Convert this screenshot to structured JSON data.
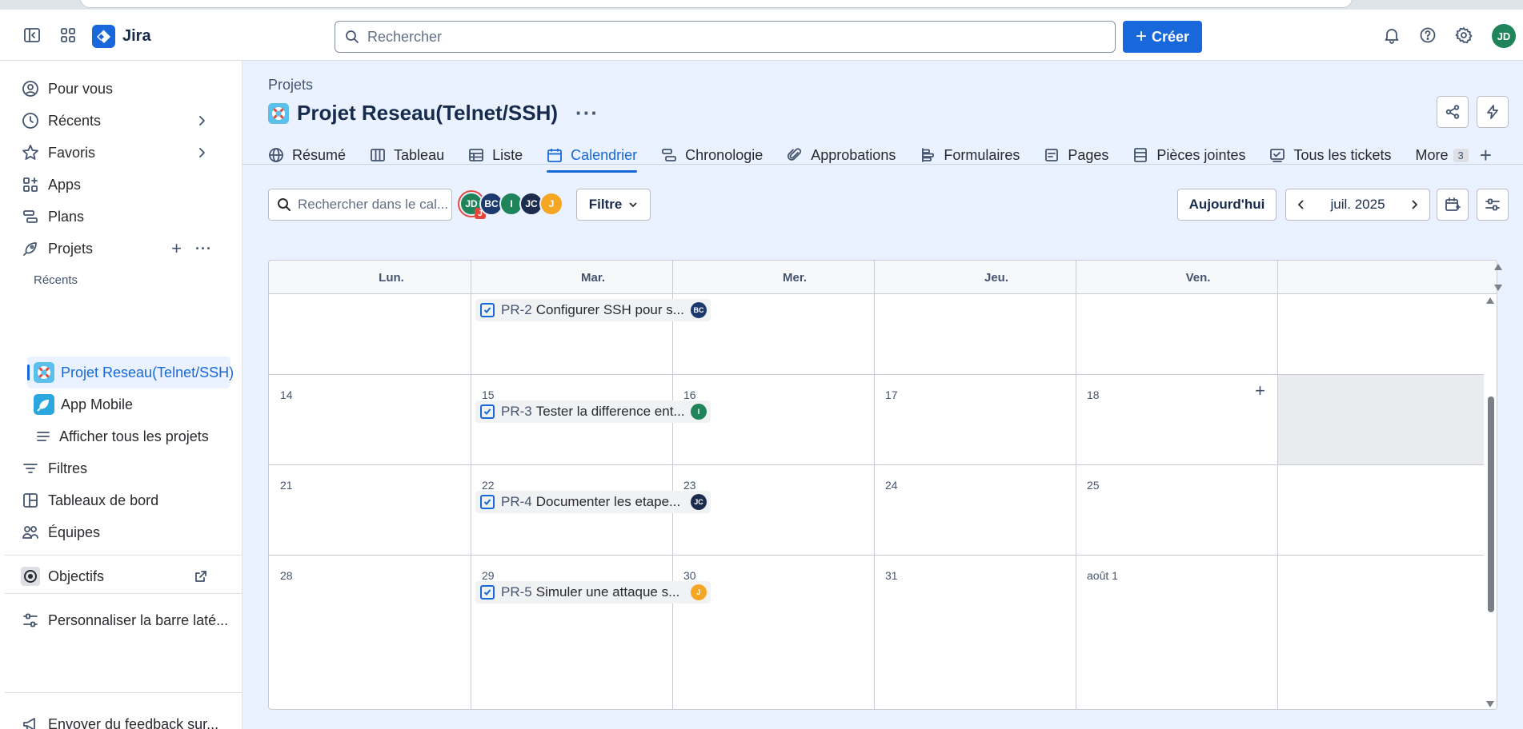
{
  "topnav": {
    "app_name": "Jira",
    "search_placeholder": "Rechercher",
    "create_label": "Créer",
    "user_initials": "JD"
  },
  "sidebar": {
    "items": [
      {
        "label": "Pour vous",
        "icon": "user-circle-icon"
      },
      {
        "label": "Récents",
        "icon": "clock-icon"
      },
      {
        "label": "Favoris",
        "icon": "star-icon"
      },
      {
        "label": "Apps",
        "icon": "apps-icon"
      },
      {
        "label": "Plans",
        "icon": "plans-icon"
      },
      {
        "label": "Projets",
        "icon": "rocket-icon"
      }
    ],
    "section_recent": "Récents",
    "projects": [
      {
        "label": "Projet Reseau(Telnet/SSH)",
        "icon": "lifebuoy-icon"
      },
      {
        "label": "App Mobile",
        "icon": "rocket-icon"
      },
      {
        "label": "Afficher tous les projets",
        "icon": "list-icon"
      }
    ],
    "items2": [
      {
        "label": "Filtres",
        "icon": "filter-icon"
      },
      {
        "label": "Tableaux de bord",
        "icon": "dashboard-icon"
      },
      {
        "label": "Équipes",
        "icon": "people-icon"
      }
    ],
    "objectifs": "Objectifs",
    "customize": "Personnaliser la barre laté...",
    "feedback": "Envoyer du feedback sur..."
  },
  "header": {
    "breadcrumb": "Projets",
    "title": "Projet Reseau(Telnet/SSH)"
  },
  "tabs": [
    {
      "label": "Résumé",
      "icon": "globe-icon"
    },
    {
      "label": "Tableau",
      "icon": "board-icon"
    },
    {
      "label": "Liste",
      "icon": "list-table-icon"
    },
    {
      "label": "Calendrier",
      "icon": "calendar-icon",
      "active": true
    },
    {
      "label": "Chronologie",
      "icon": "timeline-icon"
    },
    {
      "label": "Approbations",
      "icon": "paperclip-icon"
    },
    {
      "label": "Formulaires",
      "icon": "form-icon"
    },
    {
      "label": "Pages",
      "icon": "page-icon"
    },
    {
      "label": "Pièces jointes",
      "icon": "attachment-icon"
    },
    {
      "label": "Tous les tickets",
      "icon": "tickets-icon"
    }
  ],
  "more": {
    "label": "More",
    "count": "3"
  },
  "toolbar": {
    "search_placeholder": "Rechercher dans le cal...",
    "avatars": [
      {
        "initials": "JD",
        "color": "#1f845a"
      },
      {
        "initials": "BC",
        "color": "#1d3a6e"
      },
      {
        "initials": "I",
        "color": "#1f845a"
      },
      {
        "initials": "JC",
        "color": "#1d2b4d"
      },
      {
        "initials": "J",
        "color": "#f5a623"
      }
    ],
    "avatar_sub": "J",
    "filter_label": "Filtre",
    "today_label": "Aujourd'hui",
    "month_label": "juil. 2025"
  },
  "calendar": {
    "days": [
      "Lun.",
      "Mar.",
      "Mer.",
      "Jeu.",
      "Ven."
    ],
    "weeks": [
      {
        "dates": [
          "",
          "",
          "",
          "",
          ""
        ]
      },
      {
        "dates": [
          "14",
          "15",
          "16",
          "17",
          "18"
        ]
      },
      {
        "dates": [
          "21",
          "22",
          "23",
          "24",
          "25"
        ]
      },
      {
        "dates": [
          "28",
          "29",
          "30",
          "31",
          "août 1"
        ]
      }
    ],
    "tickets": [
      {
        "key": "PR-2",
        "summary": "Configurer SSH pour s...",
        "assignee": "BC",
        "color": "#1d3a6e"
      },
      {
        "key": "PR-3",
        "summary": "Tester la difference ent...",
        "assignee": "I",
        "color": "#1f845a"
      },
      {
        "key": "PR-4",
        "summary": "Documenter les etape...",
        "assignee": "JC",
        "color": "#1d2b4d"
      },
      {
        "key": "PR-5",
        "summary": "Simuler une attaque s...",
        "assignee": "J",
        "color": "#f5a623"
      }
    ]
  }
}
